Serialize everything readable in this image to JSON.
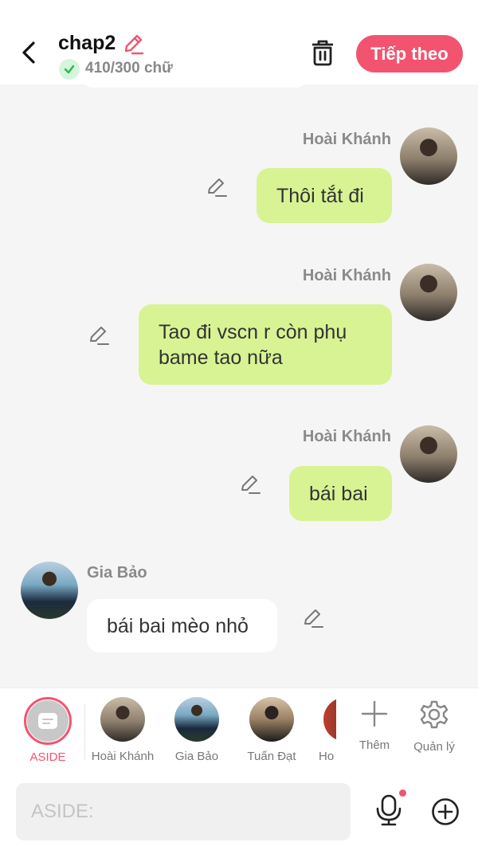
{
  "header": {
    "title": "chap2",
    "word_count": "410/300 chữ",
    "next_label": "Tiếp theo",
    "accent_color": "#f25470"
  },
  "messages": [
    {
      "sender": "Hoài Khánh",
      "text": "Thôi tắt đi",
      "side": "right",
      "bubble_color": "#d8f394"
    },
    {
      "sender": "Hoài Khánh",
      "text_line1": "Tao đi vscn r còn phụ",
      "text_line2": "bame tao nữa",
      "side": "right",
      "bubble_color": "#d8f394"
    },
    {
      "sender": "Hoài Khánh",
      "text": "bái bai",
      "side": "right",
      "bubble_color": "#d8f394"
    },
    {
      "sender": "Gia Bảo",
      "text": "bái bai mèo nhỏ",
      "side": "left",
      "bubble_color": "#ffffff"
    }
  ],
  "character_bar": {
    "aside_label": "ASIDE",
    "characters": [
      "Hoài Khánh",
      "Gia Bảo",
      "Tuấn Đạt",
      "Ho"
    ],
    "add_label": "Thêm",
    "manage_label": "Quản lý"
  },
  "input": {
    "placeholder": "ASIDE:",
    "value": ""
  },
  "icons": [
    "back-arrow-icon",
    "pencil-icon",
    "check-icon",
    "trash-icon",
    "mic-icon",
    "plus-circle-icon",
    "plus-icon",
    "gear-icon",
    "notes-icon"
  ]
}
